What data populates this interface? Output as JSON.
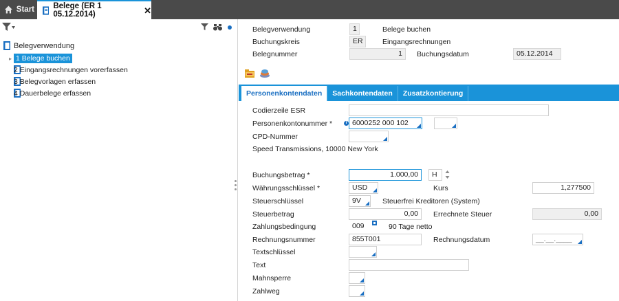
{
  "tabs": {
    "start": "Start",
    "belege": "Belege (ER 1 05.12.2014)",
    "close": "✕"
  },
  "tree": {
    "root": "Belegverwendung",
    "items": [
      {
        "label": "1  Belege buchen",
        "selected": true
      },
      {
        "label": "2  Eingangsrechnungen vorerfassen",
        "selected": false
      },
      {
        "label": "3  Belegvorlagen erfassen",
        "selected": false
      },
      {
        "label": "4  Dauerbelege erfassen",
        "selected": false
      }
    ]
  },
  "header": {
    "belegverwendung_label": "Belegverwendung",
    "belegverwendung_value": "1",
    "belegverwendung_text": "Belege buchen",
    "buchungskreis_label": "Buchungskreis",
    "buchungskreis_value": "ER",
    "buchungskreis_text": "Eingangsrechnungen",
    "belegnummer_label": "Belegnummer",
    "belegnummer_value": "1",
    "buchungsdatum_label": "Buchungsdatum",
    "buchungsdatum_value": "05.12.2014"
  },
  "subtabs": [
    "Personenkontendaten",
    "Sachkontendaten",
    "Zusatzkontierung"
  ],
  "form": {
    "codierzeile_label": "Codierzeile ESR",
    "codierzeile_value": "",
    "personenkonto_label": "Personenkontonummer *",
    "personenkonto_value": "6000252 000 102",
    "cpd_label": "CPD-Nummer",
    "cpd_value": "",
    "address": "Speed Transmissions, 10000 New York",
    "buchungsbetrag_label": "Buchungsbetrag *",
    "buchungsbetrag_value": "1.000,00",
    "sh_value": "H",
    "waehrung_label": "Währungsschlüssel *",
    "waehrung_value": "USD",
    "kurs_label": "Kurs",
    "kurs_value": "1,277500",
    "steuerschluessel_label": "Steuerschlüssel",
    "steuerschluessel_value": "9V",
    "steuerschluessel_text": "Steuerfrei Kreditoren (System)",
    "steuerbetrag_label": "Steuerbetrag",
    "steuerbetrag_value": "0,00",
    "errechnete_label": "Errechnete Steuer",
    "errechnete_value": "0,00",
    "zahlungsbedingung_label": "Zahlungsbedingung",
    "zahlungsbedingung_value": "009",
    "zahlungsbedingung_text": "90 Tage netto",
    "rechnungsnummer_label": "Rechnungsnummer",
    "rechnungsnummer_value": "855T001",
    "rechnungsdatum_label": "Rechnungsdatum",
    "rechnungsdatum_value": "__.__.____",
    "textschluessel_label": "Textschlüssel",
    "text_label": "Text",
    "mahnsperre_label": "Mahnsperre",
    "zahlweg_label": "Zahlweg"
  },
  "colors": {
    "accent": "#1a93d9",
    "tabbar": "#4a4a4a",
    "readonly": "#efefef"
  }
}
